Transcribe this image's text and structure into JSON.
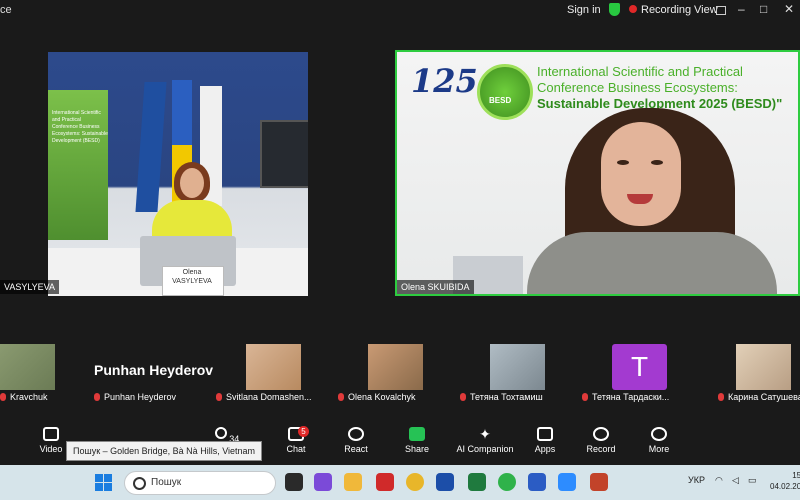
{
  "window": {
    "title": "ce",
    "minimize": "–",
    "maximize": "□",
    "close": "✕"
  },
  "topbar": {
    "sign_in": "Sign in",
    "recording": "Recording",
    "view": "View"
  },
  "videos": [
    {
      "name": "VASYLYEVA",
      "sign_text": "Olena VASYLYEVA",
      "banner_text": "International Scientific and Practical Conference Business Ecosystems: Sustainable Development (BESD)"
    },
    {
      "name": "Olena SKUIBIDA",
      "logo": "125",
      "besd": "BESD",
      "conference_line1": "International Scientific and Practical",
      "conference_line2": "Conference Business Ecosystems:",
      "conference_line3": "Sustainable Development 2025 (BESD)\""
    }
  ],
  "participants": [
    {
      "name": "Kravchuk",
      "color": "#8a9a70"
    },
    {
      "name": "Punhan Heyderov",
      "big": "Punhan Heyderov"
    },
    {
      "name": "Svitlana Domashen...",
      "color": "#c9a07a"
    },
    {
      "name": "Olena Kovalchyk",
      "color": "#b88a6a"
    },
    {
      "name": "Тетяна Тохтамиш",
      "color": "#9aa8b0"
    },
    {
      "name": "Тетяна Тардаски...",
      "letter": "T"
    },
    {
      "name": "Карина Сатушева",
      "color": "#d6c0a8"
    }
  ],
  "toolbar": {
    "video": "Video",
    "participants_count": "34",
    "chat": "Chat",
    "chat_badge": "5",
    "react": "React",
    "share": "Share",
    "ai": "AI Companion",
    "apps": "Apps",
    "record": "Record",
    "more": "More"
  },
  "tooltip": "Пошук – Golden Bridge, Bà Nà Hills, Vietnam",
  "taskbar": {
    "search_placeholder": "Пошук",
    "language": "УКР",
    "time": "15",
    "date": "04.02.20"
  }
}
